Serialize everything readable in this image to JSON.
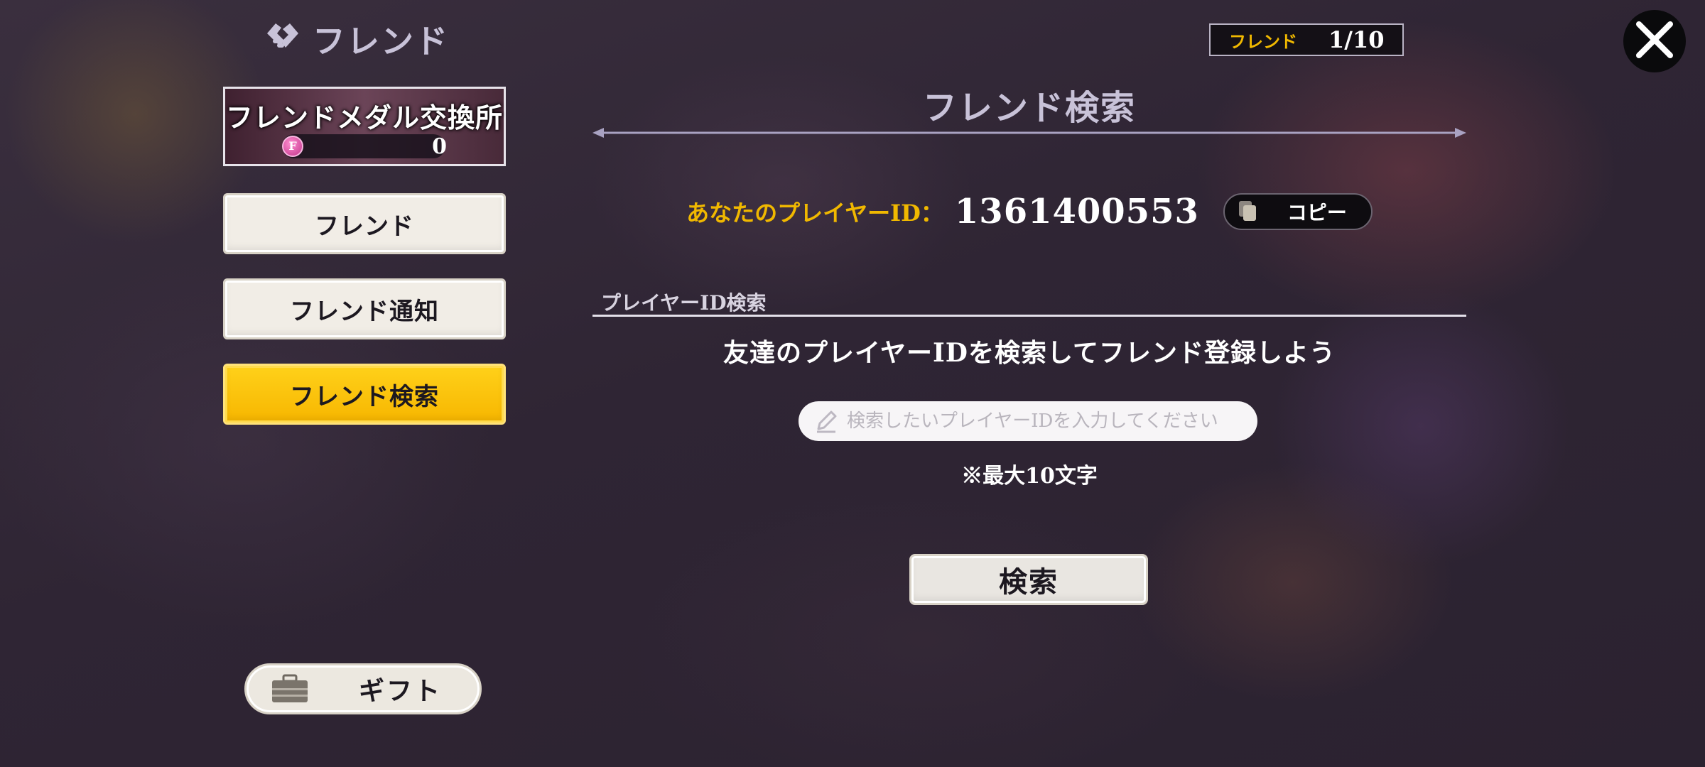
{
  "header": {
    "title": "フレンド",
    "counter_label": "フレンド",
    "counter_value": "1/10"
  },
  "sidebar": {
    "medal_exchange": {
      "title": "フレンドメダル交換所",
      "coin_letter": "F",
      "count": "0"
    },
    "items": [
      {
        "label": "フレンド",
        "active": false
      },
      {
        "label": "フレンド通知",
        "active": false
      },
      {
        "label": "フレンド検索",
        "active": true
      }
    ],
    "gift_label": "ギフト"
  },
  "main": {
    "section_title": "フレンド検索",
    "player_id_label": "あなたのプレイヤーID：",
    "player_id_value": "1361400553",
    "copy_label": "コピー",
    "subsection_label": "プレイヤーID検索",
    "instruction": "友達のプレイヤーIDを検索してフレンド登録しよう",
    "search_placeholder": "検索したいプレイヤーIDを入力してください",
    "search_value": "",
    "note": "※最大10文字",
    "search_button": "検索"
  },
  "icons": {
    "title": "handshake-icon",
    "close": "close-icon",
    "copy": "copy-icon",
    "pencil": "pencil-icon",
    "gift": "briefcase-icon",
    "coin": "medal-coin-icon"
  },
  "colors": {
    "accent_yellow": "#f0b800",
    "active_tab": "#ffc20e",
    "title_lavender": "#c8c2d8"
  }
}
